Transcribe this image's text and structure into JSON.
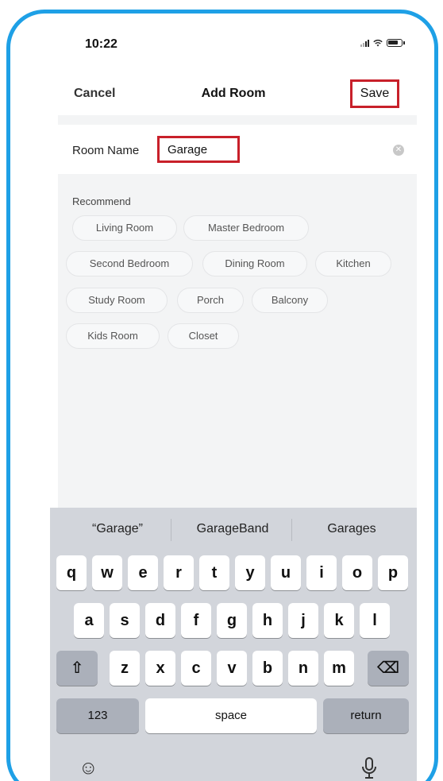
{
  "status": {
    "time": "10:22"
  },
  "nav": {
    "cancel": "Cancel",
    "title": "Add Room",
    "save": "Save"
  },
  "form": {
    "label": "Room Name",
    "value": "Garage"
  },
  "recommend": {
    "title": "Recommend",
    "chips": [
      "Living Room",
      "Master Bedroom",
      "Second Bedroom",
      "Dining Room",
      "Kitchen",
      "Study Room",
      "Porch",
      "Balcony",
      "Kids Room",
      "Closet"
    ]
  },
  "keyboard": {
    "suggestions": [
      "“Garage”",
      "GarageBand",
      "Garages"
    ],
    "row1": [
      "q",
      "w",
      "e",
      "r",
      "t",
      "y",
      "u",
      "i",
      "o",
      "p"
    ],
    "row2": [
      "a",
      "s",
      "d",
      "f",
      "g",
      "h",
      "j",
      "k",
      "l"
    ],
    "row3": [
      "z",
      "x",
      "c",
      "v",
      "b",
      "n",
      "m"
    ],
    "shift_glyph": "⇧",
    "delete_glyph": "⌫",
    "numbers_label": "123",
    "space_label": "space",
    "return_label": "return",
    "emoji_glyph": "☺",
    "mic_glyph": "🎙"
  },
  "colors": {
    "frame": "#1ea0e6",
    "highlight": "#c8202a",
    "keyboard_bg": "#d2d5db"
  }
}
